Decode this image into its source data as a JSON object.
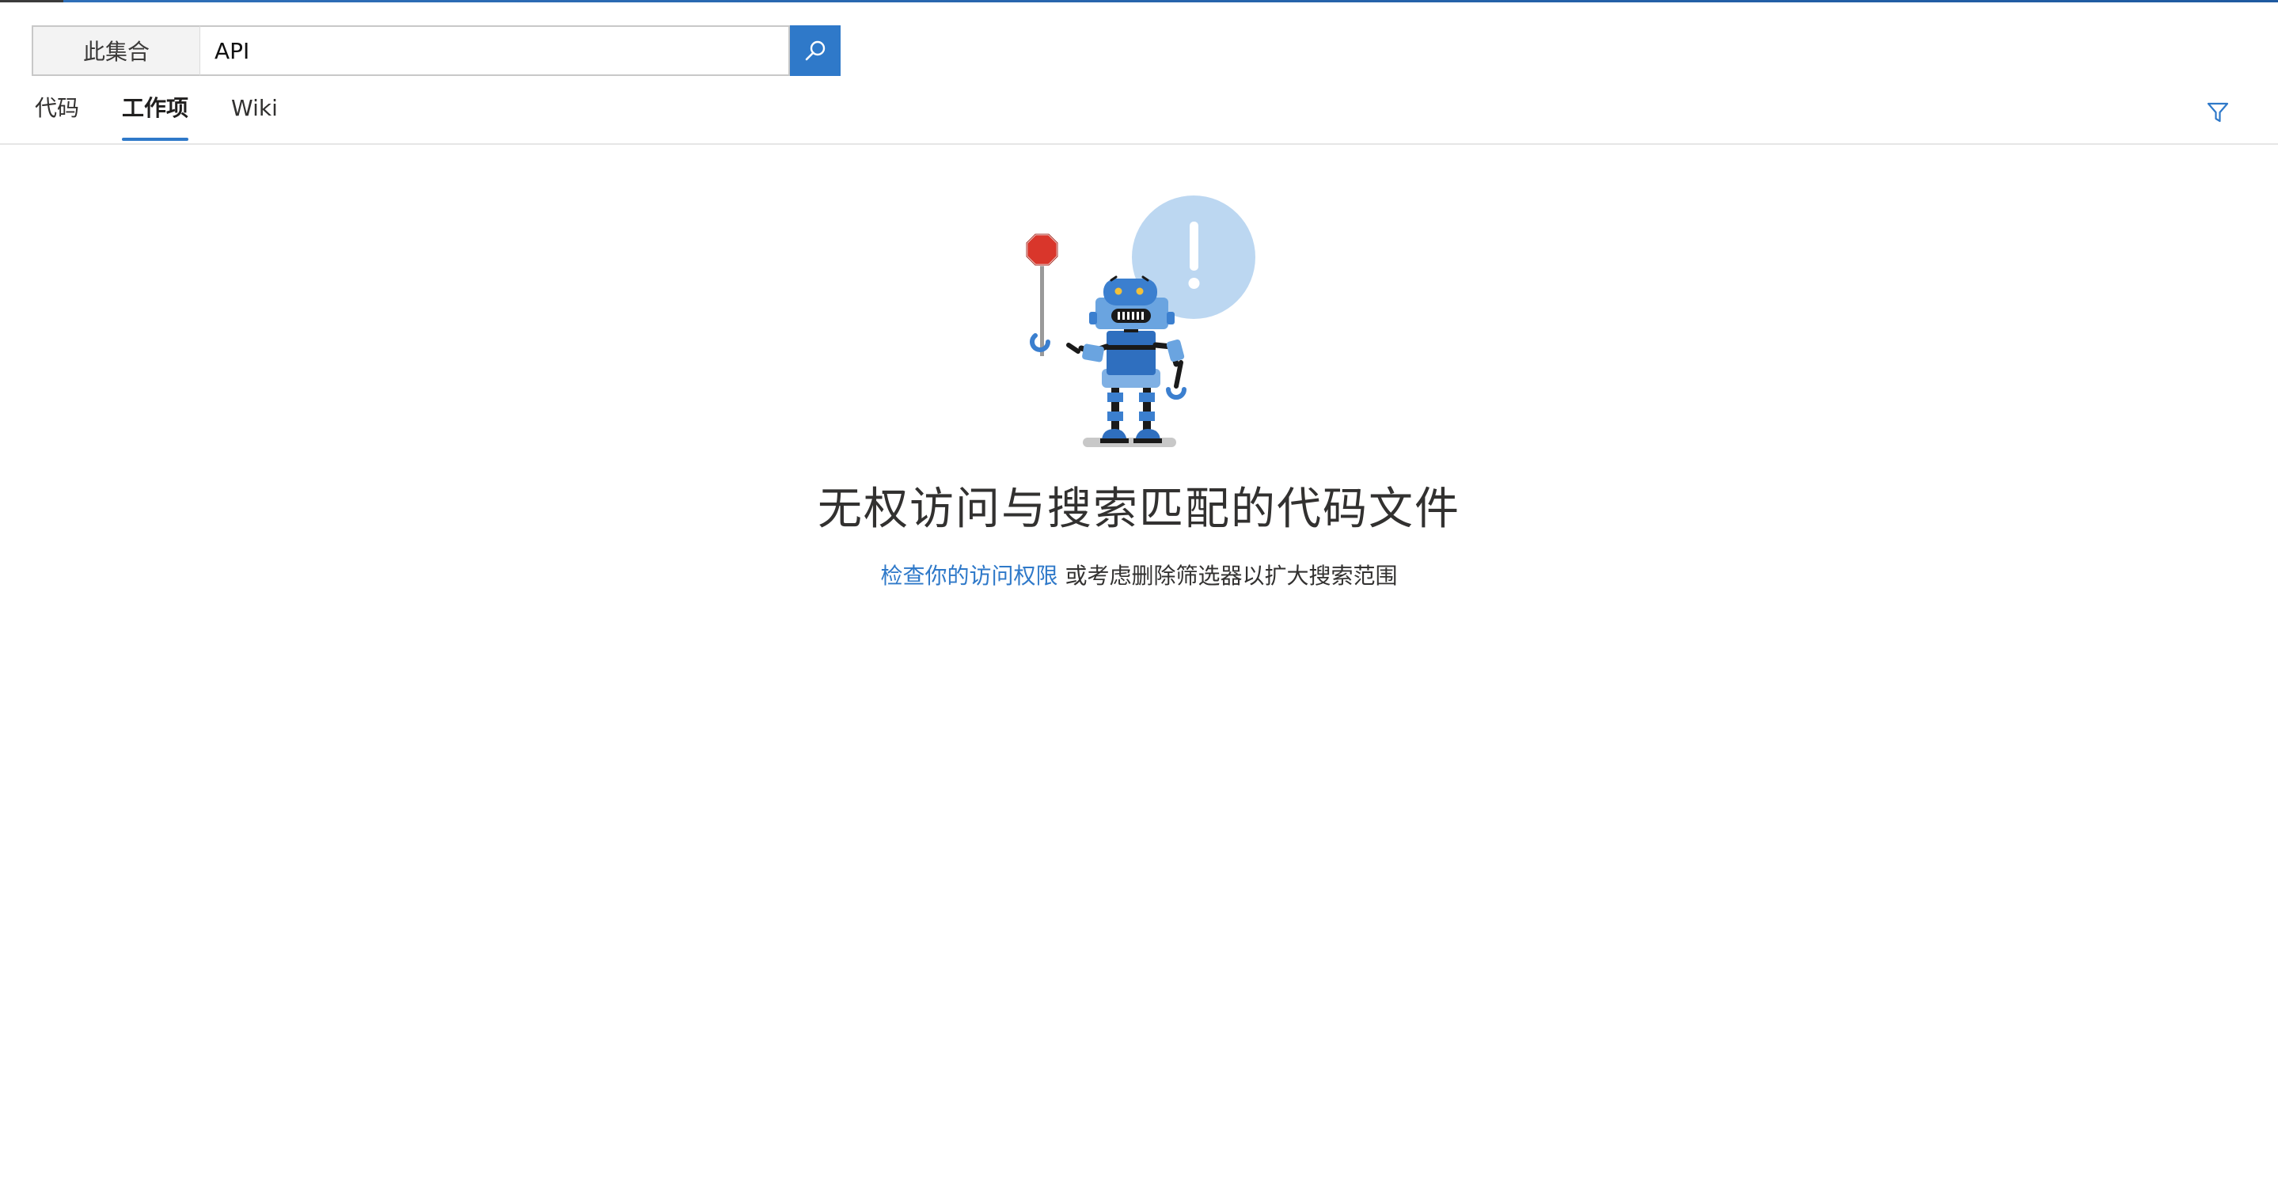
{
  "search": {
    "scope_label": "此集合",
    "query_value": "API"
  },
  "tabs": [
    {
      "label": "代码",
      "active": false
    },
    {
      "label": "工作项",
      "active": true
    },
    {
      "label": "Wiki",
      "active": false
    }
  ],
  "empty_state": {
    "title": "无权访问与搜索匹配的代码文件",
    "link_text": "检查你的访问权限",
    "suffix_text": " 或考虑删除筛选器以扩大搜索范围"
  },
  "icons": {
    "search": "search-icon",
    "filter": "filter-icon",
    "illustration": "robot-stop-sign-illustration"
  },
  "colors": {
    "accent": "#2f79c9",
    "link": "#2f79c9",
    "text": "#323130"
  }
}
